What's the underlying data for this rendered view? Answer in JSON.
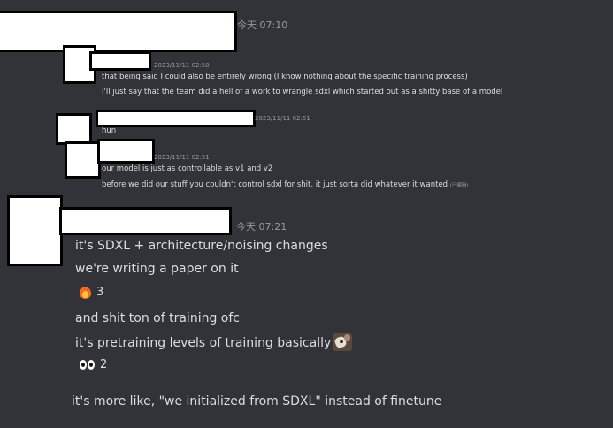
{
  "messages": {
    "first_header_time": "今天 07:10",
    "reply1_time": "2023/11/11 02:50",
    "reply1_lines": [
      "that being said I could also be entirely wrong (I know nothing about the specific training process)",
      "I'll just say that the team did a hell of a work to wrangle sdxl which started out as a shitty base of a model"
    ],
    "reply2_time": "2023/11/11 02:51",
    "reply2_line": "hun",
    "reply3_time": "2023/11/11 02:51",
    "reply3_lines": [
      "our model is just as controllable as v1 and v2",
      "before we did our stuff you couldn't control sdxl for shit, it just sorta did whatever it wanted"
    ],
    "reply3_edited": "(已编辑)",
    "second_header_time": "今天 07:21",
    "main_lines": [
      "it's SDXL + architecture/noising changes",
      "we're writing a paper on it"
    ],
    "reaction1": {
      "emoji": "fire-icon",
      "count": "3"
    },
    "more_lines": [
      "and shit ton of training ofc",
      "it's pretraining levels of training basically"
    ],
    "reaction2": {
      "emoji": "eyes-icon",
      "count": "2"
    },
    "last_line": "it's more like, \"we initialized from SDXL\" instead of finetune"
  },
  "colors": {
    "background": "#313338",
    "text": "#dbdee1",
    "muted": "#949ba4",
    "redaction": "#ffffff"
  }
}
